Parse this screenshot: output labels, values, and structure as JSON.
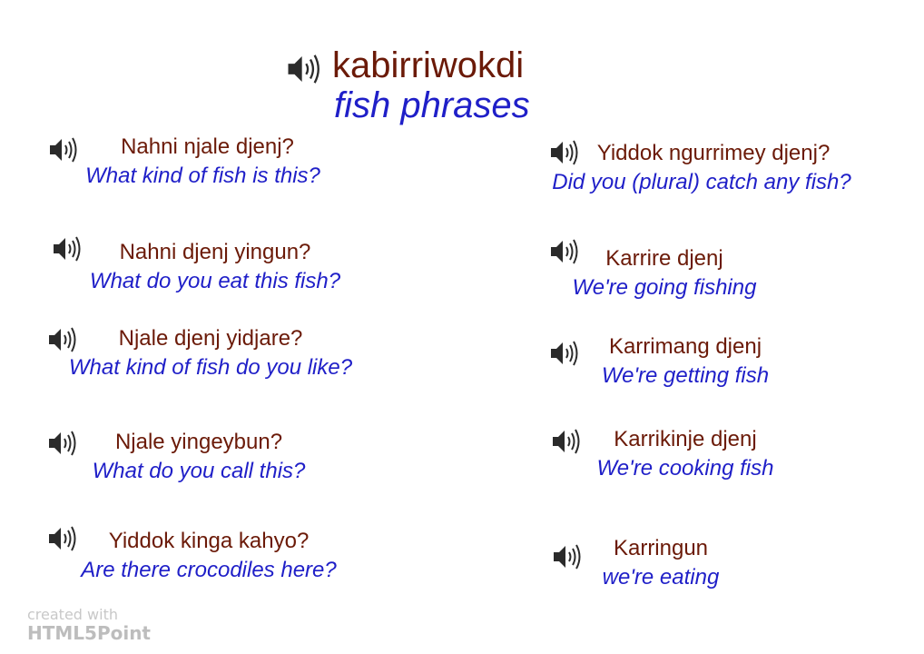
{
  "title": {
    "kunwinjku": "kabirriwokdi",
    "english": "fish phrases"
  },
  "left_phrases": [
    {
      "kunwinjku": "Nahni njale djenj?",
      "english": "What kind of fish is this?"
    },
    {
      "kunwinjku": "Nahni djenj yingun?",
      "english": "What do you eat this fish?"
    },
    {
      "kunwinjku": "Njale djenj yidjare?",
      "english": "What kind of fish do you like?"
    },
    {
      "kunwinjku": "Njale yingeybun?",
      "english": "What do you call this?"
    },
    {
      "kunwinjku": "Yiddok kinga kahyo?",
      "english": "Are there crocodiles here?"
    }
  ],
  "right_phrases": [
    {
      "kunwinjku": "Yiddok ngurrimey djenj?",
      "english": "Did you (plural) catch any fish?"
    },
    {
      "kunwinjku": "Karrire djenj",
      "english": "We're going fishing"
    },
    {
      "kunwinjku": "Karrimang djenj",
      "english": "We're getting fish"
    },
    {
      "kunwinjku": "Karrikinje djenj",
      "english": "We're cooking fish"
    },
    {
      "kunwinjku": "Karringun",
      "english": "we're eating"
    }
  ],
  "watermark": {
    "line1": "created with",
    "line2": "HTML5Point"
  },
  "icon": "speaker-icon",
  "colors": {
    "kunwinjku": "#6b1a08",
    "english": "#1f1fc8"
  }
}
